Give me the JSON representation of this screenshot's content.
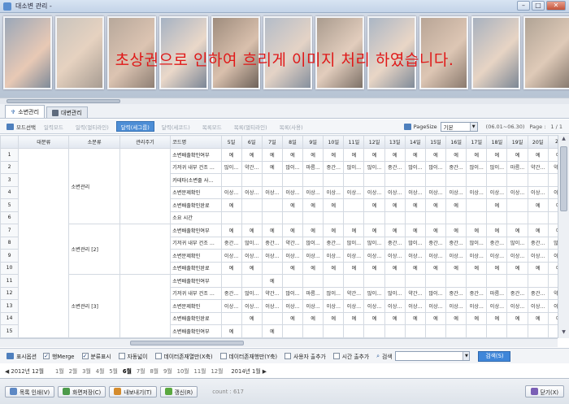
{
  "window": {
    "title": "대소변 관리 -"
  },
  "notice": "초상권으로 인하여 흐리게 이미지 처리 하였습니다.",
  "tabs": [
    {
      "label": "소변관리",
      "active": true
    },
    {
      "label": "대변관리",
      "active": false
    }
  ],
  "toolbar": {
    "mode_label": "모드선택",
    "buttons": [
      {
        "label": "일력모드",
        "active": false
      },
      {
        "label": "일력(멀티라인)",
        "active": false
      },
      {
        "label": "달력(세그룹)",
        "active": true
      },
      {
        "label": "달력(세코드)",
        "active": false
      },
      {
        "label": "목록모드",
        "active": false
      },
      {
        "label": "목록(멀티라인)",
        "active": false
      },
      {
        "label": "목록(사용)",
        "active": false
      }
    ],
    "pagesize_label": "PageSize",
    "pagesize_value": "기본",
    "date_range": "(06.01~06.30)",
    "page_label": "Page :",
    "page_value": "1 / 1"
  },
  "grid": {
    "headers": [
      "대분류",
      "소분류",
      "관리주기",
      "코드명",
      "5일",
      "6일",
      "7일",
      "8일",
      "9일",
      "10일",
      "11일",
      "12일",
      "13일",
      "14일",
      "15일",
      "16일",
      "17일",
      "18일",
      "19일",
      "20일",
      "21"
    ],
    "rows": [
      {
        "num": "1",
        "code": "소변배출확인여부",
        "cells": [
          "예",
          "예",
          "예",
          "예",
          "예",
          "예",
          "예",
          "예",
          "예",
          "예",
          "예",
          "예",
          "예",
          "예",
          "예",
          "예",
          "예"
        ]
      },
      {
        "num": "2",
        "code": "기저귀 내부 건조 ...",
        "cells": [
          "많이...",
          "약간...",
          "예",
          "많이...",
          "마름...",
          "중간...",
          "많이...",
          "많이...",
          "중간...",
          "많이...",
          "많이...",
          "중간...",
          "많이...",
          "많이...",
          "마름...",
          "약간...",
          "약간"
        ]
      },
      {
        "num": "3",
        "code": "카테타(소변줄 사...",
        "cells": [
          "",
          "",
          "",
          "",
          "",
          "",
          "",
          "",
          "",
          "",
          "",
          "",
          "",
          "",
          "",
          "",
          ""
        ]
      },
      {
        "num": "4",
        "code": "소변문제확인",
        "cells": [
          "이상...",
          "이상...",
          "이상...",
          "이상...",
          "이상...",
          "이상...",
          "이상...",
          "이상...",
          "이상...",
          "이상...",
          "이상...",
          "이상...",
          "이상...",
          "이상...",
          "이상...",
          "이상...",
          "이상"
        ]
      },
      {
        "num": "5",
        "code": "소변배출확인완료",
        "cells": [
          "예",
          "",
          "",
          "예",
          "예",
          "예",
          "",
          "예",
          "예",
          "예",
          "예",
          "예",
          "",
          "예",
          "",
          "예",
          "예"
        ]
      },
      {
        "num": "6",
        "code": "소요 시간",
        "cells": [
          "",
          "",
          "",
          "",
          "",
          "",
          "",
          "",
          "",
          "",
          "",
          "",
          "",
          "",
          "",
          "",
          ""
        ]
      },
      {
        "num": "7",
        "code": "소변배출확인여부",
        "cells": [
          "예",
          "예",
          "예",
          "예",
          "예",
          "예",
          "예",
          "예",
          "예",
          "예",
          "예",
          "예",
          "예",
          "예",
          "예",
          "예",
          "예"
        ]
      },
      {
        "num": "8",
        "code": "기저귀 내부 건조 ...",
        "cells": [
          "중간...",
          "많이...",
          "중간...",
          "약간...",
          "많이...",
          "중간...",
          "많이...",
          "많이...",
          "중간...",
          "많이...",
          "중간...",
          "중간...",
          "많이...",
          "중간...",
          "많이...",
          "중간...",
          "많이"
        ]
      },
      {
        "num": "9",
        "code": "소변문제확인",
        "cells": [
          "이상...",
          "이상...",
          "이상...",
          "이상...",
          "이상...",
          "이상...",
          "이상...",
          "이상...",
          "이상...",
          "이상...",
          "이상...",
          "이상...",
          "이상...",
          "이상...",
          "이상...",
          "이상...",
          "이상"
        ]
      },
      {
        "num": "10",
        "code": "소변배출확인완료",
        "cells": [
          "예",
          "예",
          "",
          "예",
          "예",
          "예",
          "예",
          "예",
          "예",
          "예",
          "예",
          "예",
          "예",
          "예",
          "예",
          "예",
          "예"
        ]
      },
      {
        "num": "11",
        "code": "소변배출확인여부",
        "cells": [
          "",
          "",
          "예",
          "",
          "",
          "",
          "",
          "",
          "",
          "",
          "",
          "",
          "",
          "",
          "",
          "",
          ""
        ]
      },
      {
        "num": "12",
        "code": "기저귀 내부 건조 ...",
        "cells": [
          "중간...",
          "많이...",
          "약간...",
          "많이...",
          "마름...",
          "많이...",
          "약간...",
          "많이...",
          "많이...",
          "약간...",
          "많이...",
          "중간...",
          "중간...",
          "마름...",
          "중간...",
          "중간...",
          "약간"
        ]
      },
      {
        "num": "13",
        "code": "소변문제확인",
        "cells": [
          "이상...",
          "이상...",
          "이상...",
          "이상...",
          "이상...",
          "이상...",
          "이상...",
          "이상...",
          "이상...",
          "이상...",
          "이상...",
          "이상...",
          "이상...",
          "이상...",
          "이상...",
          "이상...",
          "이상"
        ]
      },
      {
        "num": "14",
        "code": "소변배출확인완료",
        "cells": [
          "",
          "예",
          "",
          "예",
          "예",
          "예",
          "예",
          "예",
          "예",
          "예",
          "예",
          "예",
          "예",
          "예",
          "예",
          "예",
          "예"
        ]
      },
      {
        "num": "15",
        "code": "소변배출확인여부",
        "cells": [
          "예",
          "",
          "예",
          "",
          "",
          "",
          "",
          "",
          "",
          "",
          "",
          "",
          "",
          "",
          "",
          "",
          ""
        ]
      }
    ],
    "groups": [
      {
        "label": "소변관리",
        "start": 0,
        "span": 6
      },
      {
        "label": "소변관리 [2]",
        "start": 6,
        "span": 4
      },
      {
        "label": "소변관리 [3]",
        "start": 10,
        "span": 5
      }
    ]
  },
  "options": {
    "label": "표시옵션",
    "checks": [
      {
        "label": "행Merge",
        "checked": true
      },
      {
        "label": "분류표시",
        "checked": true
      },
      {
        "label": "자동넓이",
        "checked": false
      },
      {
        "label": "데이터존재열만(X축)",
        "checked": false
      },
      {
        "label": "데이터존재행만(Y축)",
        "checked": false
      },
      {
        "label": "사용자 출추가",
        "checked": false
      },
      {
        "label": "시간 출추가",
        "checked": false
      }
    ],
    "search_label": "검색",
    "search_button": "검색(S)"
  },
  "months": {
    "prev": "◀ 2012년 12월",
    "items": [
      "1월",
      "2월",
      "3월",
      "4월",
      "5월",
      "6월",
      "7월",
      "8월",
      "9월",
      "10월",
      "11월",
      "12월"
    ],
    "current_index": 5,
    "next": "2014년 1월 ▶"
  },
  "bottom": {
    "buttons": [
      "목록 인쇄(V)",
      "화면저장(C)",
      "내보내기(T)",
      "갱신(R)"
    ],
    "count": "count : 617",
    "close": "닫기(X)"
  },
  "colors": {
    "accent": "#4d8ed6",
    "notice": "#e01818"
  }
}
